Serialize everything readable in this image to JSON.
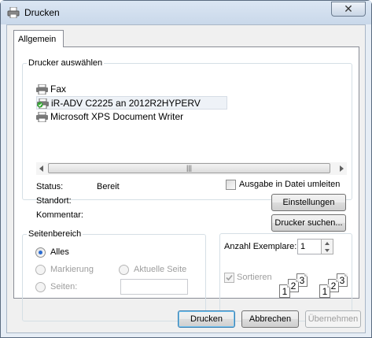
{
  "window": {
    "title": "Drucken",
    "close_glyph": "✕"
  },
  "tabs": [
    {
      "label": "Allgemein",
      "active": true
    }
  ],
  "printer_group": {
    "legend": "Drucker auswählen",
    "printers": [
      {
        "name": "Fax",
        "icon": "fax-printer-icon",
        "selected": false
      },
      {
        "name": "iR-ADV C2225 an 2012R2HYPERV",
        "icon": "default-printer-icon",
        "selected": true
      },
      {
        "name": "Microsoft XPS Document Writer",
        "icon": "printer-icon",
        "selected": false
      }
    ],
    "scroll_grip": "|||",
    "status_label": "Status:",
    "status_value": "Bereit",
    "location_label": "Standort:",
    "location_value": "",
    "comment_label": "Kommentar:",
    "comment_value": "",
    "print_to_file_label": "Ausgabe in Datei umleiten",
    "print_to_file_checked": false,
    "preferences_button": "Einstellungen",
    "find_printer_button": "Drucker suchen..."
  },
  "range_group": {
    "legend": "Seitenbereich",
    "all_label": "Alles",
    "selection_label": "Markierung",
    "current_page_label": "Aktuelle Seite",
    "pages_label": "Seiten:",
    "pages_value": "",
    "selected_option": "all"
  },
  "copies_group": {
    "copies_label": "Anzahl Exemplare:",
    "copies_value": "1",
    "collate_label": "Sortieren",
    "collate_checked": true,
    "collate_enabled": false,
    "collate_icon_pages": [
      "1",
      "2",
      "3"
    ]
  },
  "buttons": {
    "print": "Drucken",
    "cancel": "Abbrechen",
    "apply": "Übernehmen"
  },
  "colors": {
    "accent": "#2a6bd1",
    "window_frame": "#e6edf5"
  }
}
